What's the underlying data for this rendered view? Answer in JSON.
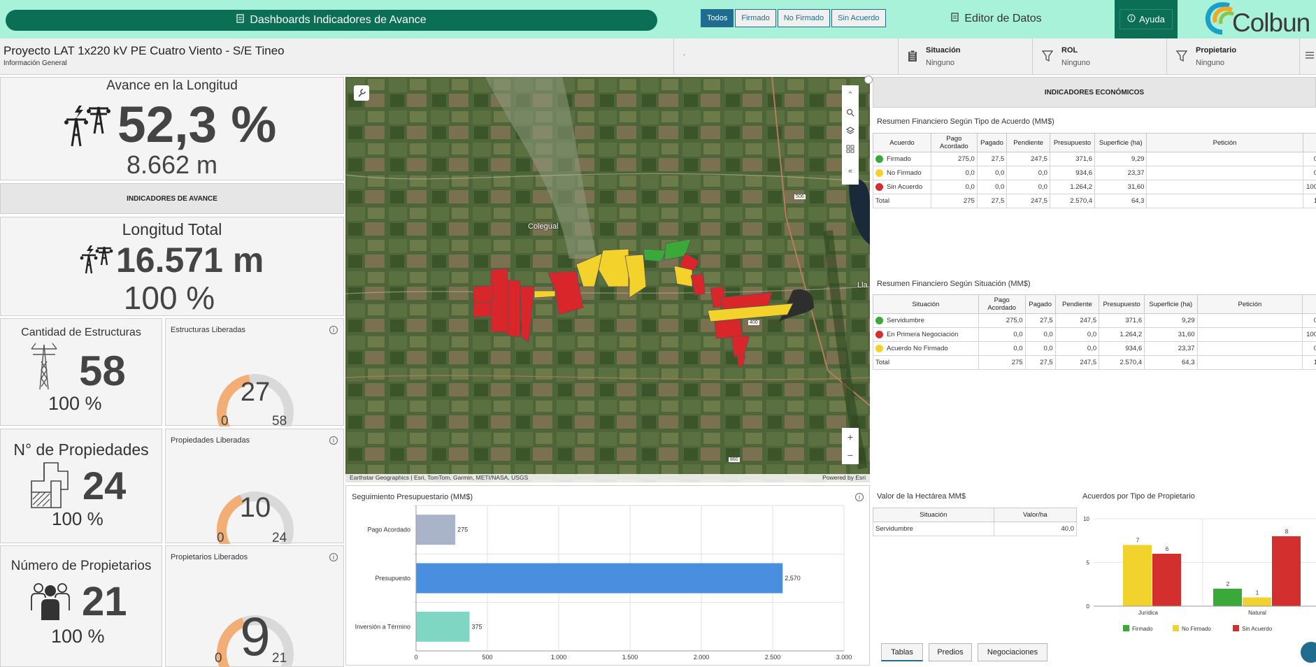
{
  "topbar": {
    "dashboard_button": "Dashboards Indicadores de Avance",
    "editor_button": "Editor de Datos",
    "help_button": "Ayuda",
    "logo_text": "Colbun"
  },
  "header": {
    "title": "Proyecto LAT 1x220 kV PE Cuatro Viento - S/E Tineo",
    "subtitle": "Información General",
    "dot": ".",
    "filter_tabs": [
      "Todos",
      "Firmado",
      "No Firmado",
      "Sin Acuerdo"
    ],
    "active_filter": "Todos",
    "selectors": [
      {
        "label": "Situación",
        "value": "Ninguno"
      },
      {
        "label": "ROL",
        "value": "Ninguno"
      },
      {
        "label": "Propietario",
        "value": "Ninguno"
      }
    ]
  },
  "kpi": {
    "avance": {
      "title": "Avance en la Longitud",
      "value": "52,3 %",
      "sub": "8.662 m"
    },
    "section_label": "INDICADORES DE AVANCE",
    "longitud": {
      "title": "Longitud Total",
      "value": "16.571 m",
      "sub": "100 %"
    },
    "estructuras": {
      "title": "Cantidad de Estructuras",
      "value": "58",
      "sub": "100 %"
    },
    "propiedades": {
      "title": "N° de Propiedades",
      "value": "24",
      "sub": "100 %"
    },
    "propietarios": {
      "title": "Número de Propietarios",
      "value": "21",
      "sub": "100 %"
    }
  },
  "gauges": [
    {
      "title": "Estructuras Liberadas",
      "value": "27",
      "min": "0",
      "max": "58",
      "fraction": 0.4655
    },
    {
      "title": "Propiedades Liberadas",
      "value": "10",
      "min": "0",
      "max": "24",
      "fraction": 0.4167
    },
    {
      "title": "Propietarios Liberados",
      "value": "9",
      "min": "0",
      "max": "21",
      "fraction": 0.4286
    }
  ],
  "map": {
    "place_label": "Colegual",
    "place_label_2": "Lla",
    "road_labels": [
      "506",
      "400",
      "860"
    ],
    "attribution": "Earthstar Geographics | Esri, TomTom, Garmin, METI/NASA, USGS",
    "powered": "Powered by Esri"
  },
  "economic": {
    "header": "INDICADORES ECONÓMICOS",
    "table1_title": "Resumen Financiero Según Tipo de Acuerdo (MM$)",
    "table1_headers": [
      "Acuerdo",
      "Pago Acordado",
      "Pagado",
      "Pendiente",
      "Presupuesto",
      "Superficie (ha)",
      "Petición",
      ""
    ],
    "table1_rows": [
      {
        "label": "Firmado",
        "color": "#3aa93a",
        "cells": [
          "275,0",
          "27,5",
          "247,5",
          "371,6",
          "9,29",
          "",
          "0"
        ]
      },
      {
        "label": "No Firmado",
        "color": "#f2d22c",
        "cells": [
          "0,0",
          "0,0",
          "0,0",
          "934,6",
          "23,37",
          "",
          "0"
        ]
      },
      {
        "label": "Sin Acuerdo",
        "color": "#d32f2f",
        "cells": [
          "0,0",
          "0,0",
          "0,0",
          "1.264,2",
          "31,60",
          "",
          "100"
        ]
      },
      {
        "label": "Total",
        "color": "",
        "cells": [
          "275",
          "27,5",
          "247,5",
          "2.570,4",
          "64,3",
          "",
          "1"
        ]
      }
    ],
    "table2_title": "Resumen Financiero Según Situación (MM$)",
    "table2_headers": [
      "Situación",
      "Pago Acordado",
      "Pagado",
      "Pendiente",
      "Presupuesto",
      "Superficie (ha)",
      "Petición",
      ""
    ],
    "table2_rows": [
      {
        "label": "Servidumbre",
        "color": "#3aa93a",
        "cells": [
          "275,0",
          "27,5",
          "247,5",
          "371,6",
          "9,29",
          "",
          "0"
        ]
      },
      {
        "label": "En Primera Negociación",
        "color": "#d32f2f",
        "cells": [
          "0,0",
          "0,0",
          "0,0",
          "1.264,2",
          "31,60",
          "",
          "100"
        ]
      },
      {
        "label": "Acuerdo No Firmado",
        "color": "#f2d22c",
        "cells": [
          "0,0",
          "0,0",
          "0,0",
          "934,6",
          "23,37",
          "",
          "0"
        ]
      },
      {
        "label": "Total",
        "color": "",
        "cells": [
          "275",
          "27,5",
          "247,5",
          "2.570,4",
          "64,3",
          "",
          "1"
        ]
      }
    ],
    "hectarea_title": "Valor de la Hectárea MM$",
    "hectarea_headers": [
      "Situación",
      "Valor/ha"
    ],
    "hectarea_rows": [
      [
        "Servidumbre",
        "40,0"
      ]
    ]
  },
  "chart_data": [
    {
      "type": "bar",
      "orientation": "horizontal",
      "title": "Seguimiento Presupuestario (MM$)",
      "categories": [
        "Pago Acordado",
        "Presupuesto",
        "Inversión a Término"
      ],
      "values": [
        275,
        2570,
        375
      ],
      "value_labels": [
        "275",
        "2,570",
        "375"
      ],
      "colors": [
        "#a9b4c9",
        "#4a8ee0",
        "#7fd6c2"
      ],
      "xlim": [
        0,
        3000
      ],
      "xticks": [
        "0",
        "500",
        "1.000",
        "1.500",
        "2.000",
        "2.500",
        "3.000"
      ],
      "grid": true
    },
    {
      "type": "bar",
      "title": "Acuerdos por Tipo de Propietario",
      "categories": [
        "Jurídica",
        "Natural"
      ],
      "series": [
        {
          "name": "Firmado",
          "color": "#3aa93a",
          "values": [
            0,
            2
          ]
        },
        {
          "name": "No Firmado",
          "color": "#f2d22c",
          "values": [
            7,
            1
          ]
        },
        {
          "name": "Sin Acuerdo",
          "color": "#d32f2f",
          "values": [
            6,
            8
          ]
        }
      ],
      "ylim": [
        0,
        10
      ],
      "yticks": [
        "0",
        "5",
        "10"
      ],
      "legend": "bottom"
    }
  ],
  "bottom_tabs": [
    "Tablas",
    "Predios",
    "Negociaciones"
  ],
  "active_bottom_tab": "Tablas"
}
